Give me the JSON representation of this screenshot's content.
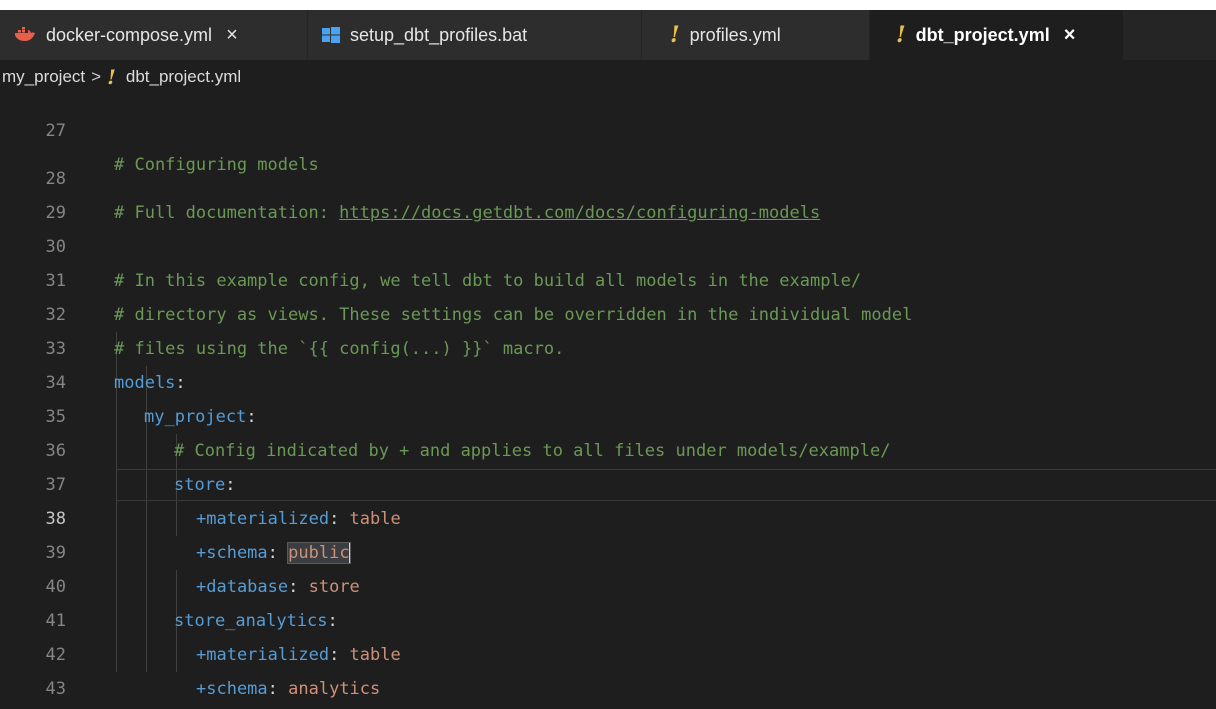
{
  "tabs": [
    {
      "label": "docker-compose.yml",
      "icon": "docker-icon",
      "close": "×",
      "active": false
    },
    {
      "label": "setup_dbt_profiles.bat",
      "icon": "windows-icon",
      "close": "",
      "active": false
    },
    {
      "label": "profiles.yml",
      "icon": "yaml-exclamation-icon",
      "close": "",
      "active": false
    },
    {
      "label": "dbt_project.yml",
      "icon": "yaml-exclamation-icon",
      "close": "×",
      "active": true
    }
  ],
  "breadcrumb": {
    "folder": "my_project",
    "separator": ">",
    "file": "dbt_project.yml"
  },
  "editor": {
    "current_line": "38",
    "lines": [
      {
        "num": "27",
        "comment": "# Configuring models"
      },
      {
        "num": "28",
        "comment": "# Full documentation: ",
        "link": "https://docs.getdbt.com/docs/configuring-models"
      },
      {
        "num": "29"
      },
      {
        "num": "30",
        "comment": "# In this example config, we tell dbt to build all models in the example/"
      },
      {
        "num": "31",
        "comment": "# directory as views. These settings can be overridden in the individual model"
      },
      {
        "num": "32",
        "comment": "# files using the `{{ config(...) }}` macro."
      },
      {
        "num": "33",
        "key": "models",
        "colon": ":"
      },
      {
        "num": "34",
        "key": "my_project",
        "colon": ":"
      },
      {
        "num": "35",
        "comment": "# Config indicated by + and applies to all files under models/example/"
      },
      {
        "num": "36",
        "key": "store",
        "colon": ":"
      },
      {
        "num": "37",
        "key": "+materialized",
        "colon": ": ",
        "value": "table"
      },
      {
        "num": "38",
        "key": "+schema",
        "colon": ": ",
        "value": "public"
      },
      {
        "num": "39",
        "key": "+database",
        "colon": ": ",
        "value": "store"
      },
      {
        "num": "40",
        "key": "store_analytics",
        "colon": ":"
      },
      {
        "num": "41",
        "key": "+materialized",
        "colon": ": ",
        "value": "table"
      },
      {
        "num": "42",
        "key": "+schema",
        "colon": ": ",
        "value": "analytics"
      },
      {
        "num": "43",
        "key": "+database",
        "colon": ": ",
        "value": "store"
      }
    ]
  },
  "colors": {
    "comment": "#6a9955",
    "key": "#569cd6",
    "value": "#ce9178",
    "background": "#1e1e1e",
    "yaml_icon": "#e8c14a",
    "docker_icon": "#e8604c",
    "windows_icon": "#4aa3f0"
  }
}
